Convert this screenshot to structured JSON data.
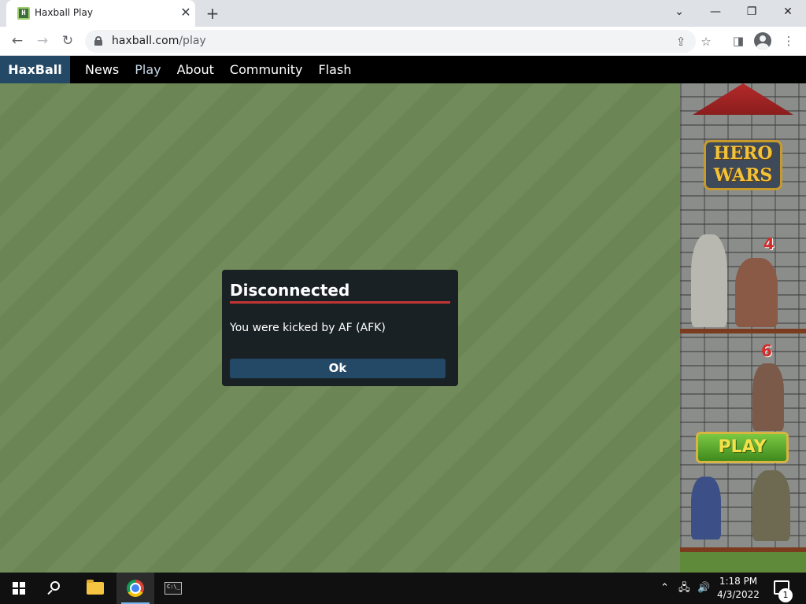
{
  "browser": {
    "tab_title": "Haxball Play",
    "tab_favicon": "H",
    "url_host": "haxball.com",
    "url_path": "/play",
    "icons": [
      "back-arrow-icon",
      "forward-arrow-icon",
      "reload-icon",
      "lock-icon",
      "share-icon",
      "star-icon",
      "side-panel-icon",
      "profile-icon",
      "more-menu-icon",
      "tab-search-chevron-icon",
      "minimize-icon",
      "restore-icon",
      "close-icon"
    ]
  },
  "site": {
    "brand": "HaxBall",
    "nav": [
      {
        "label": "News"
      },
      {
        "label": "Play"
      },
      {
        "label": "About"
      },
      {
        "label": "Community"
      },
      {
        "label": "Flash"
      }
    ],
    "active_nav": "Play"
  },
  "dialog": {
    "title": "Disconnected",
    "message": "You were kicked by AF (AFK)",
    "ok_label": "Ok"
  },
  "ad": {
    "logo_line1": "HERO",
    "logo_line2": "WARS",
    "number_top": "4",
    "number_mid": "6",
    "play_label": "PLAY"
  },
  "taskbar": {
    "time": "1:18 PM",
    "date": "4/3/2022",
    "notification_count": "1",
    "cmd_label": "C:\\_"
  },
  "colors": {
    "site_brand_bg": "#244967",
    "dialog_bg": "#1a2125",
    "dialog_rule": "#c13535",
    "field_green": "#718c5a"
  }
}
